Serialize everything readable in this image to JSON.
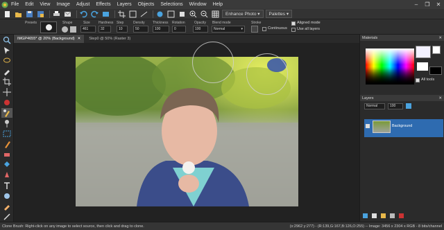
{
  "menu": [
    "File",
    "Edit",
    "View",
    "Image",
    "Adjust",
    "Effects",
    "Layers",
    "Objects",
    "Selections",
    "Window",
    "Help"
  ],
  "toolbar": {
    "enhance_photo": "Enhance Photo",
    "palettes": "Palettes"
  },
  "tool_options": {
    "presets_label": "Presets",
    "shape_label": "Shape",
    "size_label": "Size",
    "size_value": "461",
    "hardness_label": "Hardness",
    "hardness_value": "32",
    "step_label": "Step",
    "step_value": "10",
    "density_label": "Density",
    "density_value": "50",
    "thickness_label": "Thickness",
    "thickness_value": "100",
    "rotation_label": "Rotation",
    "rotation_value": "0",
    "opacity_label": "Opacity",
    "opacity_value": "100",
    "blend_label": "Blend mode",
    "blend_value": "Normal",
    "stroke_label": "Stroke",
    "continuous_label": "Continuous",
    "aligned_label": "Aligned mode",
    "use_all_layers_label": "Use all layers"
  },
  "tabs": [
    {
      "label": "IMGP4655* @  20% (Background)",
      "active": true
    },
    {
      "label": "Step0 @  50% (Raster 3)",
      "active": false
    }
  ],
  "materials": {
    "title": "Materials",
    "all_tools_label": "All tools"
  },
  "layers": {
    "title": "Layers",
    "blend_value": "Normal",
    "opacity_value": "100",
    "layer_name": "Background"
  },
  "status": {
    "hint": "Clone Brush: Right-click on any image to select source, then click and drag to clone.",
    "info": "(x:2962 y:277) - (R:139,G:167,B:126,O:255) -- Image: 3456 x 2304 x RGB - 8 bits/channel"
  },
  "colors": {
    "accent": "#2f7fd0",
    "layer_selected": "#2e6bb0",
    "canvas_bg": "#222222"
  }
}
